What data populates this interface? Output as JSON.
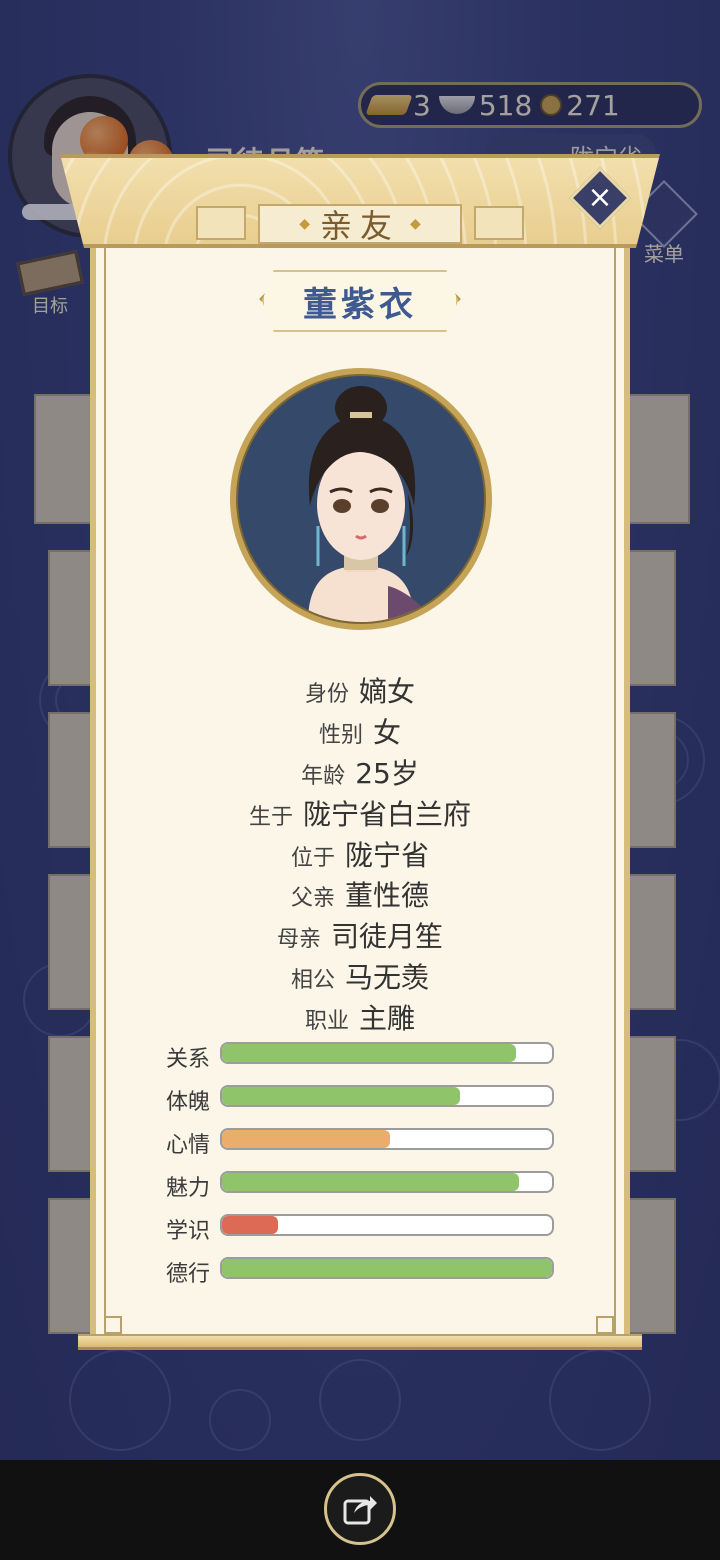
{
  "hud": {
    "player_name": "司徒月笙",
    "gold": "3",
    "silver": "518",
    "coins": "271",
    "region": "陇宁省",
    "menu_label": "菜单",
    "target_label": "目标"
  },
  "modal": {
    "title": "亲友",
    "name": "董紫衣",
    "info": [
      {
        "key": "身份",
        "value": "嫡女"
      },
      {
        "key": "性别",
        "value": "女"
      },
      {
        "key": "年龄",
        "value": "25岁"
      },
      {
        "key": "生于",
        "value": "陇宁省白兰府"
      },
      {
        "key": "位于",
        "value": "陇宁省"
      },
      {
        "key": "父亲",
        "value": "董性德"
      },
      {
        "key": "母亲",
        "value": "司徒月笙"
      },
      {
        "key": "相公",
        "value": "马无羡"
      },
      {
        "key": "职业",
        "value": "主雕"
      }
    ],
    "stats": [
      {
        "label": "关系",
        "value": 0.89,
        "color": "#8fc46a"
      },
      {
        "label": "体魄",
        "value": 0.72,
        "color": "#8fc46a"
      },
      {
        "label": "心情",
        "value": 0.51,
        "color": "#e9ad6c"
      },
      {
        "label": "魅力",
        "value": 0.9,
        "color": "#8fc46a"
      },
      {
        "label": "学识",
        "value": 0.17,
        "color": "#dc6a55"
      },
      {
        "label": "德行",
        "value": 1.0,
        "color": "#8fc46a"
      }
    ]
  }
}
